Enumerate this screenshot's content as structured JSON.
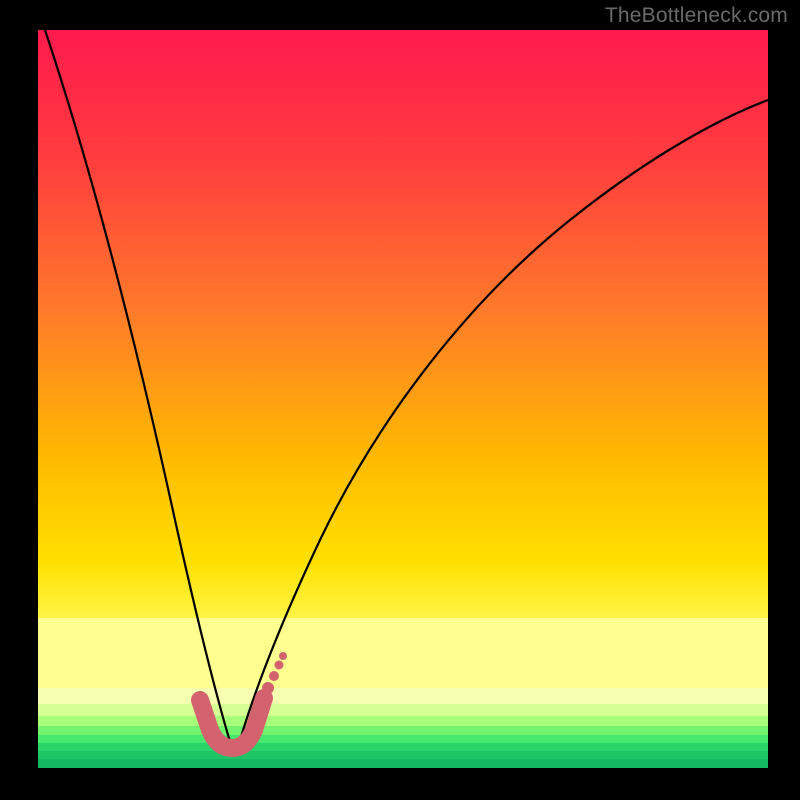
{
  "watermark": "TheBottleneck.com",
  "colors": {
    "top": "#ff1a4d",
    "mid1": "#ff7a2a",
    "mid2": "#ffd400",
    "band": "#ffff80",
    "low": "#e9ffb0",
    "green1": "#9eff78",
    "green2": "#46e86e",
    "green3": "#21cf6a",
    "green4": "#14b862",
    "accent": "#d1626e",
    "curve": "#000000",
    "frame": "#000000"
  },
  "chart_data": {
    "type": "line",
    "title": "",
    "xlabel": "",
    "ylabel": "",
    "xlim": [
      0,
      100
    ],
    "ylim": [
      0,
      100
    ],
    "series": [
      {
        "name": "bottleneck-curve",
        "x": [
          0,
          4,
          8,
          12,
          15,
          18,
          21,
          23,
          25,
          26.5,
          28,
          30,
          33,
          38,
          45,
          53,
          62,
          72,
          83,
          95,
          100
        ],
        "values": [
          100,
          89,
          78,
          66,
          55,
          44,
          33,
          24,
          15,
          6,
          1,
          4,
          10,
          20,
          33,
          45,
          56,
          66,
          76,
          85,
          88
        ]
      },
      {
        "name": "optimal-highlight",
        "x": [
          22.5,
          24.2,
          26.0,
          27.0,
          28.4,
          30.5,
          32.5
        ],
        "values": [
          7.0,
          4.0,
          2.2,
          2.0,
          2.2,
          4.0,
          7.0
        ]
      }
    ],
    "annotations": []
  }
}
